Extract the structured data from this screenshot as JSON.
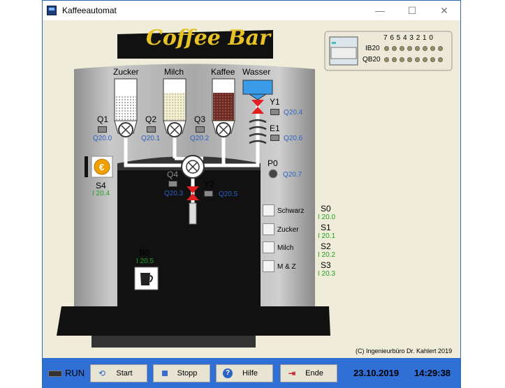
{
  "window": {
    "title": "Kaffeeautomat",
    "minimize": "—",
    "maximize": "☐",
    "close": "✕"
  },
  "sign": "Coffee Bar",
  "plc": {
    "bits": "7 6 5 4 3 2 1 0",
    "input_row": "IB20",
    "output_row": "QB20"
  },
  "containers": [
    {
      "label": "Zucker"
    },
    {
      "label": "Milch"
    },
    {
      "label": "Kaffee"
    },
    {
      "label": "Wasser"
    }
  ],
  "valves": [
    {
      "name": "Q1",
      "addr": "Q20.0"
    },
    {
      "name": "Q2",
      "addr": "Q20.1"
    },
    {
      "name": "Q3",
      "addr": "Q20.2"
    },
    {
      "name": "Q4",
      "addr": "Q20.3"
    },
    {
      "name": "Y1",
      "addr": "Q20.4"
    },
    {
      "name": "E1",
      "addr": "Q20.6"
    },
    {
      "name": "Y2",
      "addr": "Q20.5"
    },
    {
      "name": "P0",
      "addr": "Q20.7"
    }
  ],
  "coin": {
    "name": "S4",
    "addr": "I 20.4"
  },
  "cup": {
    "name": "B0",
    "addr": "I 20.5"
  },
  "selections": [
    {
      "label": "Schwarz",
      "name": "S0",
      "addr": "I 20.0"
    },
    {
      "label": "Zucker",
      "name": "S1",
      "addr": "I 20.1"
    },
    {
      "label": "Milch",
      "name": "S2",
      "addr": "I 20.2"
    },
    {
      "label": "M & Z",
      "name": "S3",
      "addr": "I 20.3"
    }
  ],
  "copyright": "(C) Ingenieurbüro Dr. Kahlert 2019",
  "toolbar": {
    "run": "RUN",
    "start": "Start",
    "stop": "Stopp",
    "help": "Hilfe",
    "end": "Ende"
  },
  "status": {
    "date": "23.10.2019",
    "time": "14:29:38"
  }
}
